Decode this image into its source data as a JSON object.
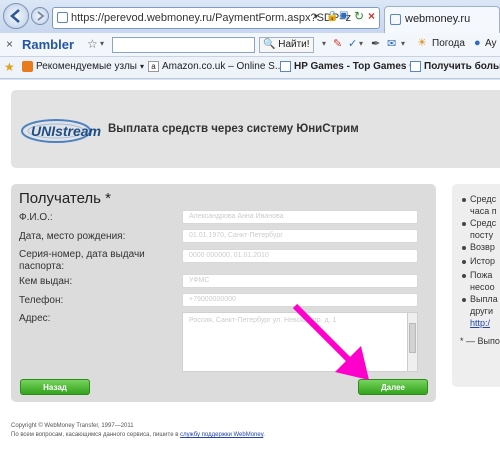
{
  "browser": {
    "address": "https://perevod.webmoney.ru/PaymentForm.aspx?SDP=z",
    "tab_title": "webmoney.ru",
    "rambler_brand": "Rambler",
    "search_button": "Найти!",
    "weather_label": "Погода",
    "tab_fragment": "Ау",
    "favorites": [
      {
        "label": "Рекомендуемые узлы"
      },
      {
        "label": "Amazon.co.uk – Online S..."
      },
      {
        "label": "HP Games - Top Games"
      },
      {
        "label": "Получить больше"
      }
    ]
  },
  "header": {
    "logo": "UNIstream",
    "title": "Выплата средств через систему ЮниСтрим"
  },
  "form": {
    "section_title": "Получатель *",
    "fields": [
      {
        "label": "Ф.И.О.:",
        "value": "Александрова Анна Иванова"
      },
      {
        "label": "Дата, место рождения:",
        "value": "01.01.1970, Санкт-Петербург"
      },
      {
        "label": "Серия-номер, дата выдачи паспорта:",
        "value": "0000 000000, 01.01.2010"
      },
      {
        "label": "Кем выдан:",
        "value": "УФМС"
      },
      {
        "label": "Телефон:",
        "value": "+79000000000"
      }
    ],
    "address_label": "Адрес:",
    "address_value": "Россия, Санкт-Петербург ул. Невский пр. д. 1",
    "back_button": "Назад",
    "next_button": "Далее"
  },
  "sidebar": {
    "items": [
      "Средс",
      "часа п",
      "Средс",
      "посту",
      "Возвр",
      "Истор",
      "Пожа",
      "несоо",
      "Выпла",
      "други",
      "http:/"
    ],
    "note": "* — Выпо"
  },
  "footer": {
    "copyright": "Copyright © WebMoney Transfer, 1997—2011",
    "support_text": "По всем вопросам, касающимся данного сервиса, пишите в",
    "support_link": "службу поддержки WebMoney"
  },
  "colors": {
    "accent_green": "#34a21d",
    "arrow": "#ff00cc",
    "brand_blue": "#1e4e88"
  }
}
